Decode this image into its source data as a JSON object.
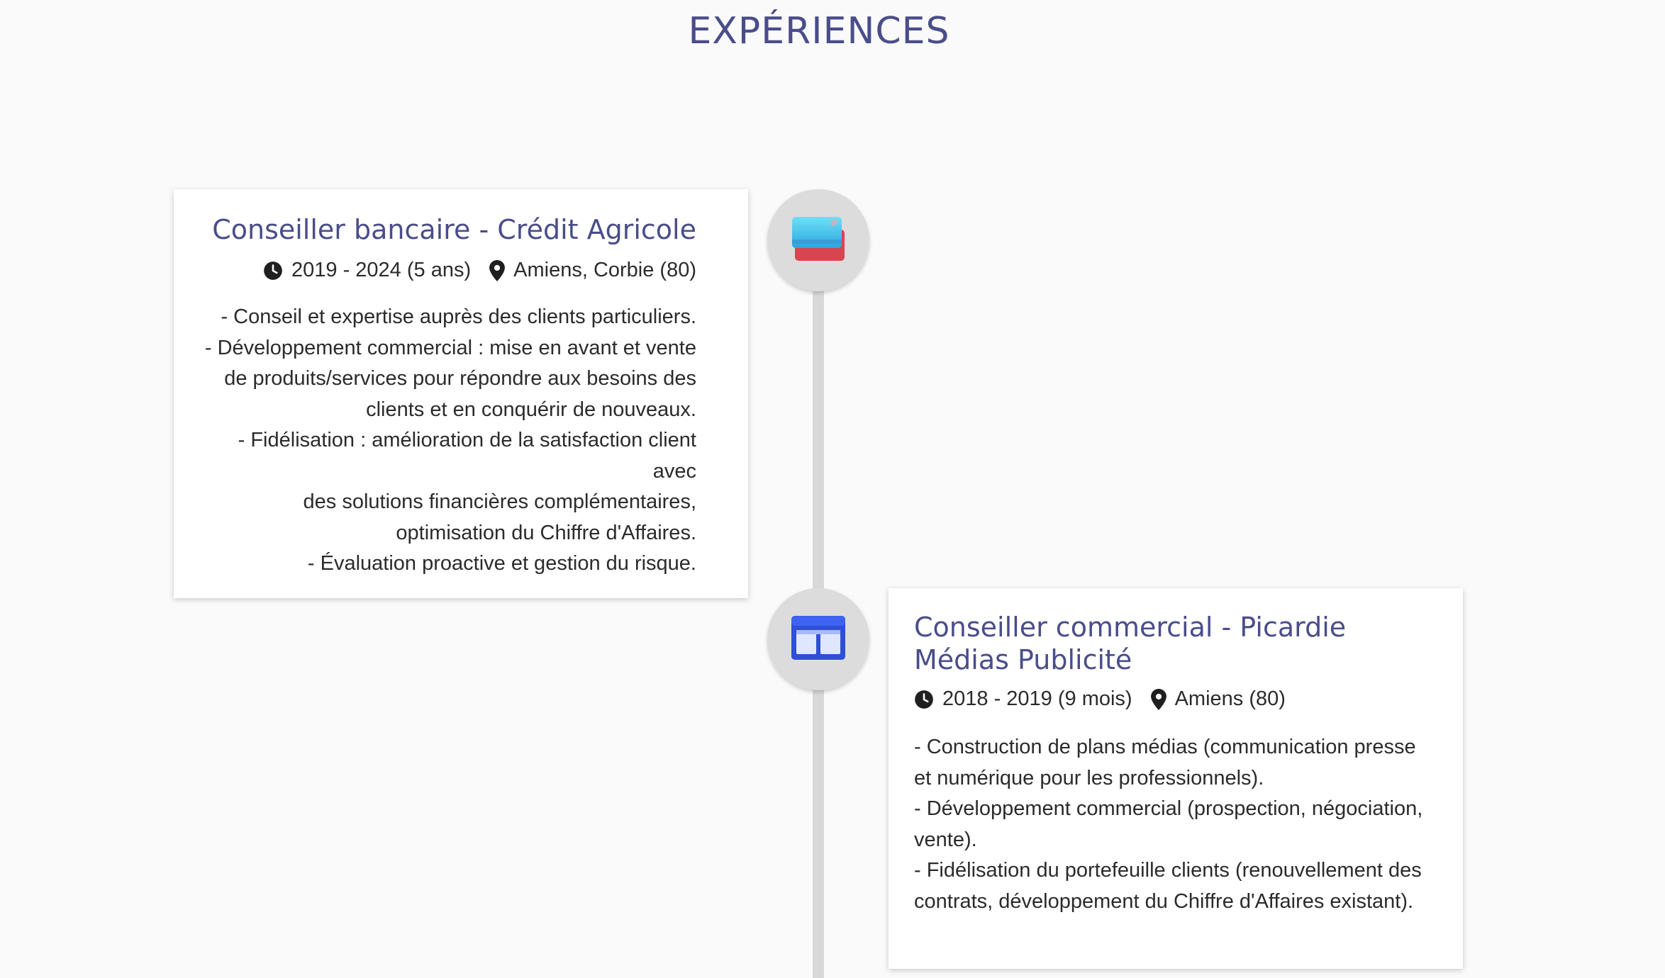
{
  "section": {
    "title": "EXPÉRIENCES"
  },
  "experiences": [
    {
      "title": "Conseiller bancaire - Crédit Agricole",
      "period": "2019 - 2024 (5 ans)",
      "location": "Amiens, Corbie (80)",
      "icon": "credit-card-icon",
      "lines": [
        "- Conseil et expertise auprès des clients particuliers.",
        "- Développement commercial : mise en avant et vente",
        "de produits/services pour répondre aux besoins des",
        "clients et en conquérir de nouveaux.",
        "- Fidélisation : amélioration de la satisfaction client avec",
        "des solutions financières complémentaires,",
        "optimisation du Chiffre d'Affaires.",
        "- Évaluation proactive et gestion du risque."
      ]
    },
    {
      "title_line1": "Conseiller commercial - Picardie",
      "title_line2": "Médias Publicité",
      "period": "2018 - 2019 (9 mois)",
      "location": "Amiens (80)",
      "icon": "newspaper-icon",
      "lines": [
        "- Construction de plans médias (communication presse",
        "et numérique pour les professionnels).",
        "- Développement commercial (prospection, négociation,",
        "vente).",
        "- Fidélisation du portefeuille clients (renouvellement des",
        "contrats, développement du Chiffre d'Affaires existant)."
      ]
    }
  ],
  "colors": {
    "accent": "#4a4d8a",
    "background": "#fafafa",
    "timeline": "#d9d9d9",
    "node": "#dcdcdc"
  }
}
